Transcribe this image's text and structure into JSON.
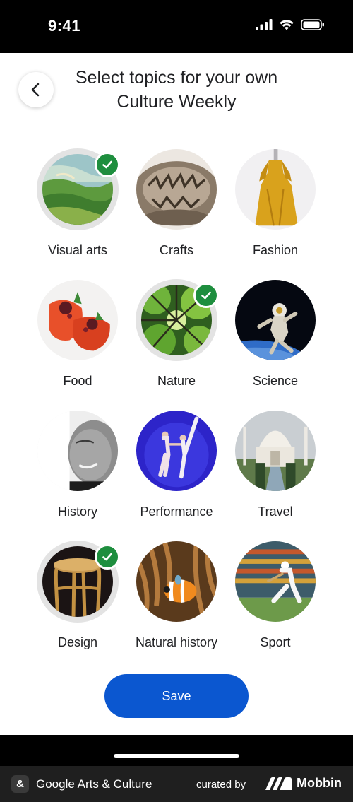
{
  "status_bar": {
    "time": "9:41"
  },
  "header": {
    "title": "Select topics for your own Culture Weekly"
  },
  "topics": [
    {
      "label": "Visual arts",
      "selected": true,
      "image": "painting-field"
    },
    {
      "label": "Crafts",
      "selected": false,
      "image": "carved-bowl"
    },
    {
      "label": "Fashion",
      "selected": false,
      "image": "yellow-dress"
    },
    {
      "label": "Food",
      "selected": false,
      "image": "plated-dish"
    },
    {
      "label": "Nature",
      "selected": true,
      "image": "tree-canopy"
    },
    {
      "label": "Science",
      "selected": false,
      "image": "astronaut"
    },
    {
      "label": "History",
      "selected": false,
      "image": "portrait-photo"
    },
    {
      "label": "Performance",
      "selected": false,
      "image": "dancers"
    },
    {
      "label": "Travel",
      "selected": false,
      "image": "taj-mahal"
    },
    {
      "label": "Design",
      "selected": true,
      "image": "wooden-stool"
    },
    {
      "label": "Natural history",
      "selected": false,
      "image": "clownfish"
    },
    {
      "label": "Sport",
      "selected": false,
      "image": "cricket-player"
    }
  ],
  "actions": {
    "save_label": "Save"
  },
  "footer": {
    "app_icon": "&",
    "app_name": "Google Arts & Culture",
    "curated_by": "curated by",
    "brand": "Mobbin"
  },
  "colors": {
    "accent": "#0b57d0",
    "check": "#1e8e3e"
  }
}
